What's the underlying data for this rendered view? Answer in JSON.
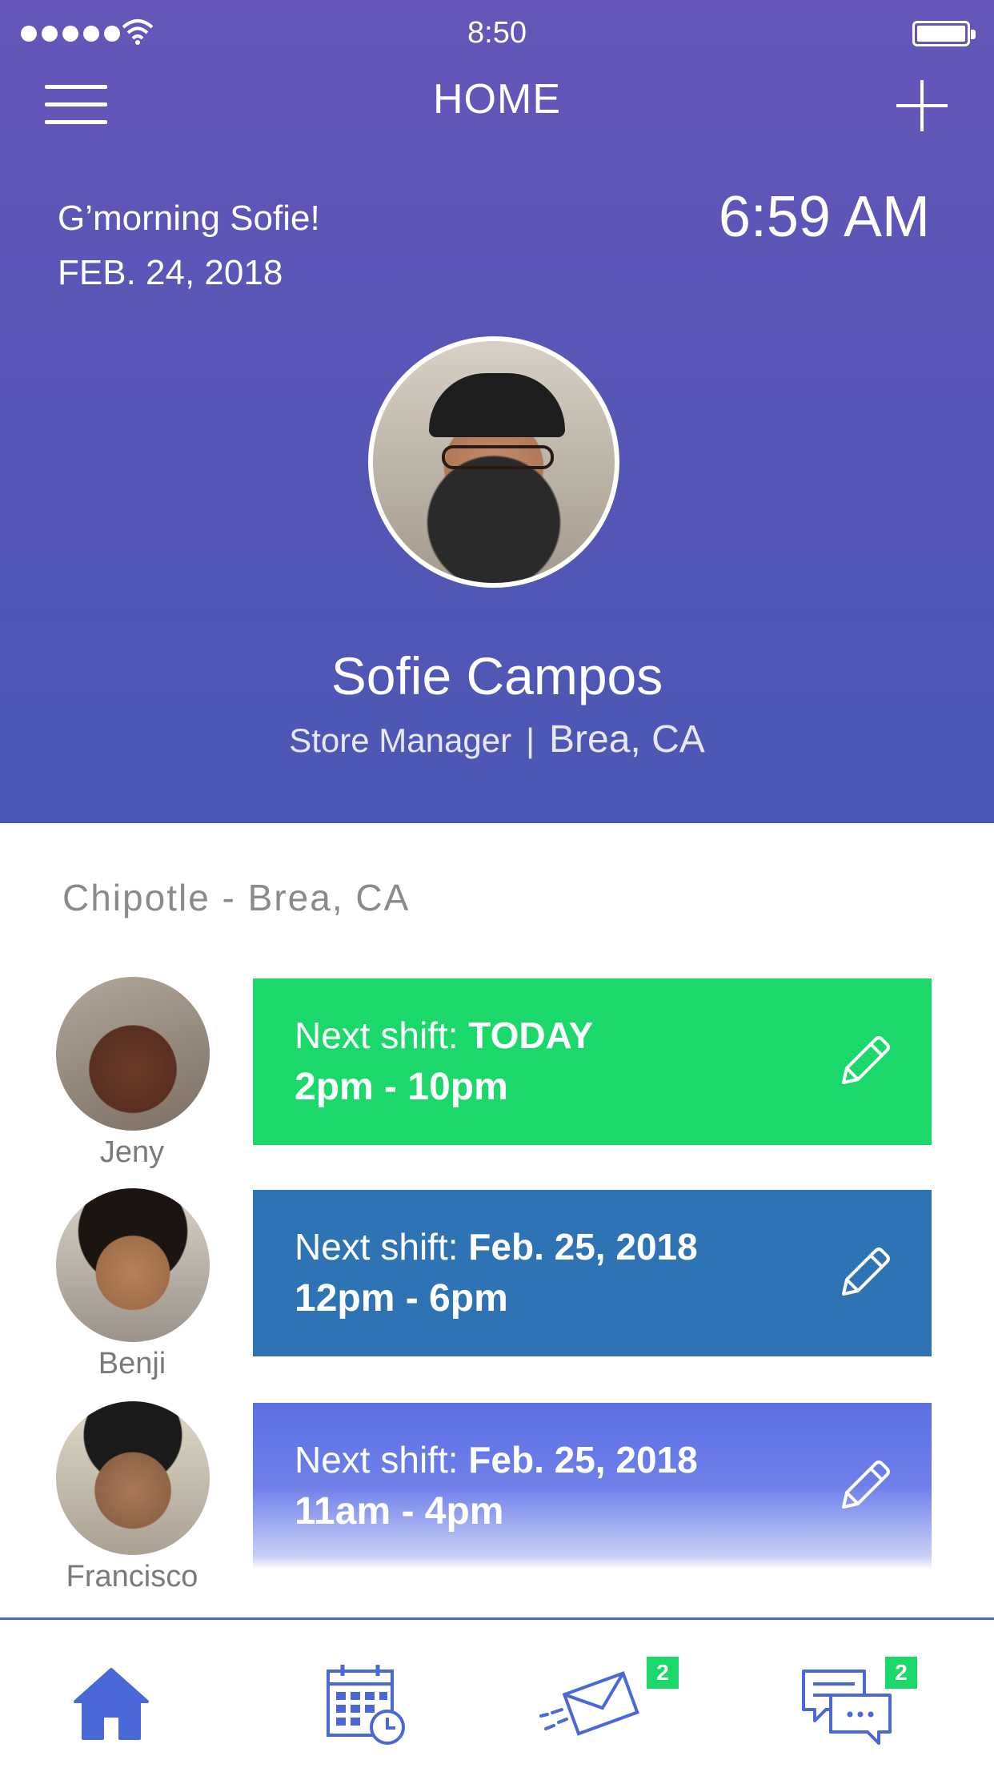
{
  "status_bar": {
    "time": "8:50"
  },
  "nav": {
    "title": "HOME"
  },
  "header": {
    "greeting": "G’morning Sofie!",
    "date": "FEB. 24, 2018",
    "clock": "6:59 AM"
  },
  "profile": {
    "name": "Sofie Campos",
    "role": "Store Manager",
    "separator": "|",
    "location": "Brea, CA"
  },
  "store": {
    "name": "Chipotle - Brea, CA"
  },
  "shifts": [
    {
      "name": "Jeny",
      "label": "Next shift:",
      "when": "TODAY",
      "hours": "2pm - 10pm",
      "color": "#1ad869"
    },
    {
      "name": "Benji",
      "label": "Next shift:",
      "when": "Feb. 25, 2018",
      "hours": "12pm - 6pm",
      "color": "#2e73b3"
    },
    {
      "name": "Francisco",
      "label": "Next shift:",
      "when": "Feb. 25, 2018",
      "hours": "11am - 4pm",
      "color": "#5b6fe3"
    }
  ],
  "tabs": {
    "home_icon": "home-icon",
    "schedule_icon": "calendar-clock-icon",
    "mail_icon": "envelope-icon",
    "mail_badge": "2",
    "chat_icon": "chat-bubbles-icon",
    "chat_badge": "2"
  },
  "colors": {
    "accent": "#4a68d8",
    "header_top": "#6457b8",
    "header_bottom": "#4c57b4",
    "badge": "#1ad869"
  }
}
